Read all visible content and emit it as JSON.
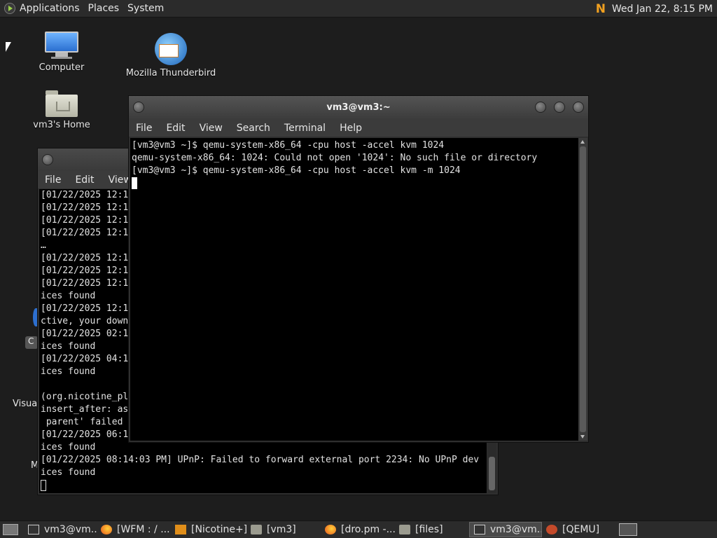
{
  "top_panel": {
    "menus": [
      "Applications",
      "Places",
      "System"
    ],
    "tray_icon": "nicotine-plus-icon",
    "clock": "Wed Jan 22,  8:15 PM"
  },
  "desktop": {
    "icons": [
      {
        "label": "Computer",
        "icon": "computer-icon"
      },
      {
        "label": "Mozilla Thunderbird",
        "icon": "thunderbird-icon"
      },
      {
        "label": "vm3's Home",
        "icon": "home-folder-icon"
      }
    ],
    "partial_labels": [
      "C",
      "Visual",
      "M"
    ]
  },
  "back_window": {
    "menu": [
      "File",
      "Edit",
      "View"
    ],
    "lines": [
      "[01/22/2025 12:1",
      "[01/22/2025 12:1",
      "[01/22/2025 12:1",
      "[01/22/2025 12:1",
      "…",
      "[01/22/2025 12:1",
      "[01/22/2025 12:1",
      "[01/22/2025 12:1",
      "ices found",
      "[01/22/2025 12:1",
      "ctive, your down",
      "[01/22/2025 02:1",
      "ices found",
      "[01/22/2025 04:1",
      "ices found",
      "",
      "(org.nicotine_pl",
      "insert_after: as",
      " parent' failed",
      "[01/22/2025 06:1",
      "ices found",
      "[01/22/2025 08:14:03 PM] UPnP: Failed to forward external port 2234: No UPnP dev",
      "ices found"
    ]
  },
  "front_window": {
    "title": "vm3@vm3:~",
    "menu": [
      "File",
      "Edit",
      "View",
      "Search",
      "Terminal",
      "Help"
    ],
    "lines": [
      "[vm3@vm3 ~]$ qemu-system-x86_64 -cpu host -accel kvm 1024",
      "qemu-system-x86_64: 1024: Could not open '1024': No such file or directory",
      "[vm3@vm3 ~]$ qemu-system-x86_64 -cpu host -accel kvm -m 1024"
    ]
  },
  "taskbar": {
    "tasks": [
      {
        "label": "vm3@vm...",
        "icon": "terminal-icon",
        "active": false
      },
      {
        "label": "[WFM : / ...",
        "icon": "firefox-icon",
        "active": false
      },
      {
        "label": "[Nicotine+]",
        "icon": "nicotine-icon",
        "active": false
      },
      {
        "label": "[vm3]",
        "icon": "folder-icon",
        "active": false
      },
      {
        "label": "[dro.pm -...",
        "icon": "firefox-icon",
        "active": false
      },
      {
        "label": "[files]",
        "icon": "folder-icon",
        "active": false
      },
      {
        "label": "vm3@vm...",
        "icon": "terminal-icon",
        "active": true
      },
      {
        "label": "[QEMU]",
        "icon": "qemu-icon",
        "active": false
      }
    ]
  }
}
